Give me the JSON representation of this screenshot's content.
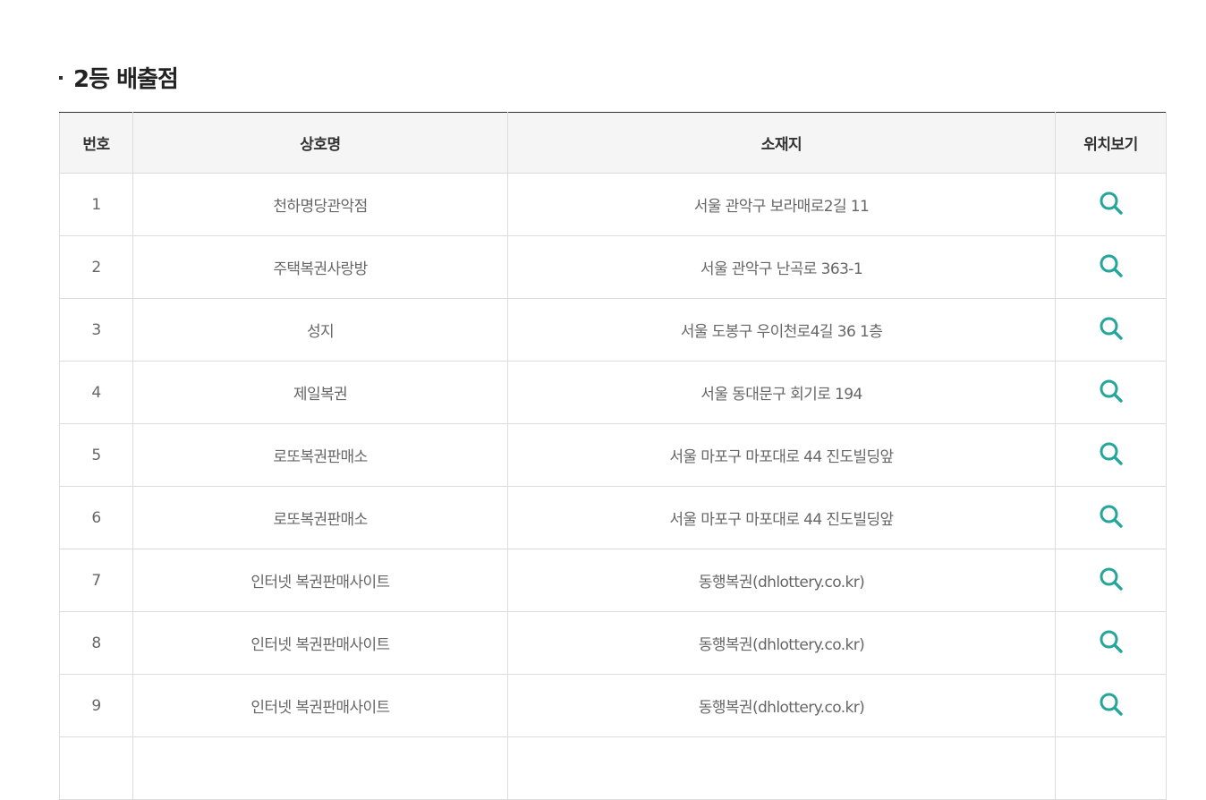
{
  "section": {
    "title": "2등 배출점"
  },
  "table": {
    "headers": {
      "no": "번호",
      "name": "상호명",
      "address": "소재지",
      "map": "위치보기"
    },
    "rows": [
      {
        "no": "1",
        "name": "천하명당관악점",
        "address": "서울 관악구 보라매로2길 11"
      },
      {
        "no": "2",
        "name": "주택복권사랑방",
        "address": "서울 관악구 난곡로 363-1"
      },
      {
        "no": "3",
        "name": "성지",
        "address": "서울 도봉구 우이천로4길 36 1층"
      },
      {
        "no": "4",
        "name": "제일복권",
        "address": "서울 동대문구 회기로 194"
      },
      {
        "no": "5",
        "name": "로또복권판매소",
        "address": "서울 마포구 마포대로 44 진도빌딩앞"
      },
      {
        "no": "6",
        "name": "로또복권판매소",
        "address": "서울 마포구 마포대로 44 진도빌딩앞"
      },
      {
        "no": "7",
        "name": "인터넷 복권판매사이트",
        "address": "동행복권(dhlottery.co.kr)"
      },
      {
        "no": "8",
        "name": "인터넷 복권판매사이트",
        "address": "동행복권(dhlottery.co.kr)"
      },
      {
        "no": "9",
        "name": "인터넷 복권판매사이트",
        "address": "동행복권(dhlottery.co.kr)"
      },
      {
        "no": "",
        "name": "",
        "address": ""
      }
    ]
  },
  "colors": {
    "accent_icon": "#26a69a",
    "header_bg": "#f5f5f5",
    "border": "#dcdcdc"
  },
  "icons": {
    "map_view": "search-icon"
  }
}
